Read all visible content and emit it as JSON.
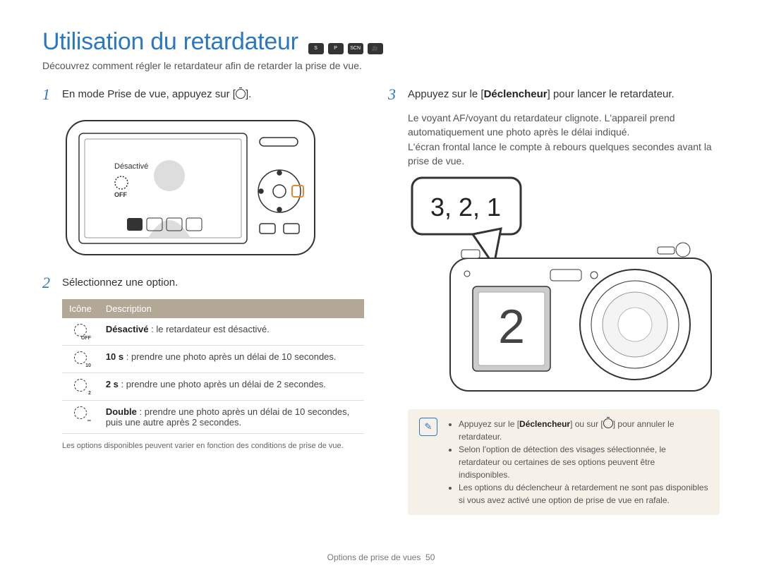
{
  "title": "Utilisation du retardateur",
  "subtitle": "Découvrez comment régler le retardateur afin de retarder la prise de vue.",
  "left": {
    "step1": {
      "text": "En mode Prise de vue, appuyez sur [",
      "text_after": "]."
    },
    "camera_screen_label": "Désactivé",
    "camera_screen_sub": "OFF",
    "step2": {
      "text": "Sélectionnez une option."
    },
    "table": {
      "headers": [
        "Icône",
        "Description"
      ],
      "rows": [
        {
          "icon_sub": "OFF",
          "label": "Désactivé",
          "desc": " : le retardateur est désactivé."
        },
        {
          "icon_sub": "10",
          "label": "10 s",
          "desc": " : prendre une photo après un délai de 10 secondes."
        },
        {
          "icon_sub": "2",
          "label": "2 s",
          "desc": " : prendre une photo après un délai de 2 secondes."
        },
        {
          "icon_sub": "",
          "label": "Double",
          "desc": " : prendre une photo après un délai de 10 secondes, puis une autre après 2 secondes."
        }
      ]
    },
    "footnote": "Les options disponibles peuvent varier en fonction des conditions de prise de vue."
  },
  "right": {
    "step3": {
      "text_before": "Appuyez sur le [",
      "bold": "Déclencheur",
      "text_after": "] pour lancer le retardateur."
    },
    "sub_lines": [
      "Le voyant AF/voyant du retardateur clignote. L'appareil prend automatiquement une photo après le délai indiqué.",
      "L'écran frontal lance le compte à rebours quelques secondes avant la prise de vue."
    ],
    "bubble": "3, 2, 1",
    "front_counter": "2",
    "note": {
      "items": [
        {
          "pre": "Appuyez sur le [",
          "bold": "Déclencheur",
          "mid": "] ou sur [",
          "post": "] pour annuler le retardateur."
        },
        {
          "text": "Selon l'option de détection des visages sélectionnée, le retardateur ou certaines de ses options peuvent être indisponibles."
        },
        {
          "text": "Les options du déclencheur à retardement ne sont pas disponibles si vous avez activé une option de prise de vue en rafale."
        }
      ]
    }
  },
  "footer": {
    "label": "Options de prise de vues",
    "page": "50"
  }
}
